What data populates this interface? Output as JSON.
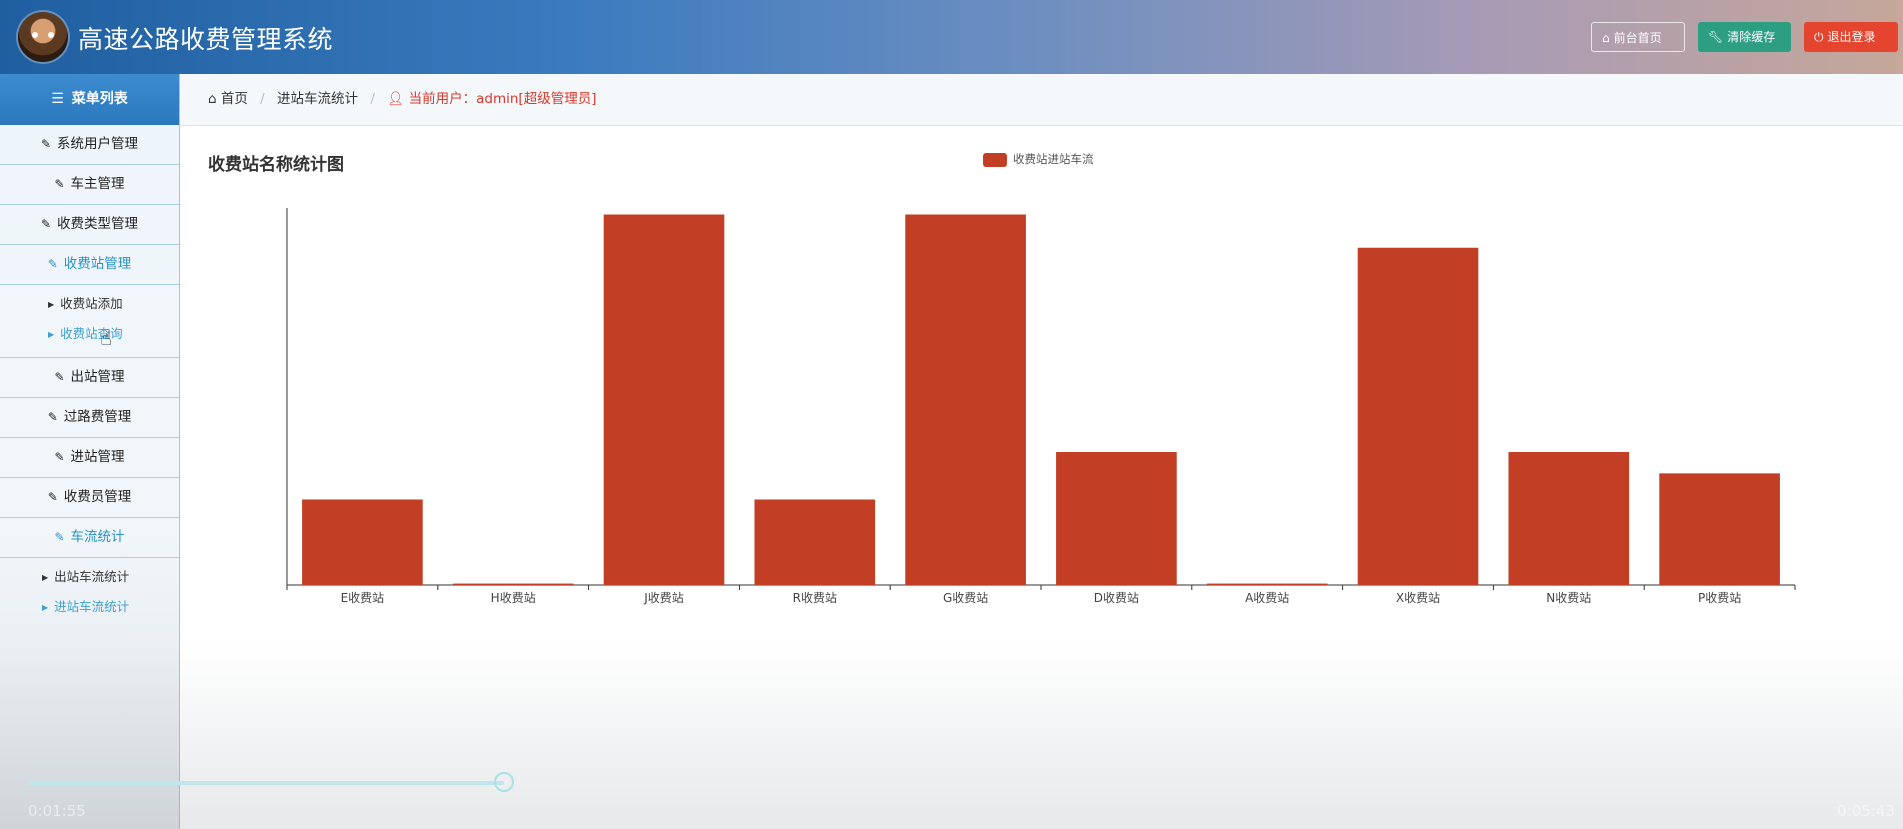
{
  "header": {
    "title": "高速公路收费管理系统",
    "buttons": {
      "home": "前台首页",
      "clear_cache": "清除缓存",
      "logout": "退出登录"
    },
    "icons": {
      "home": "home-icon",
      "clear_cache": "wrench-icon",
      "logout": "power-icon"
    }
  },
  "sidebar": {
    "heading": "菜单列表",
    "items": [
      {
        "label": "系统用户管理"
      },
      {
        "label": "车主管理"
      },
      {
        "label": "收费类型管理"
      },
      {
        "label": "收费站管理",
        "active": true,
        "children": [
          "收费站添加",
          "收费站查询"
        ]
      },
      {
        "label": "出站管理"
      },
      {
        "label": "过路费管理"
      },
      {
        "label": "进站管理"
      },
      {
        "label": "收费员管理"
      },
      {
        "label": "车流统计",
        "active": true,
        "children": [
          "出站车流统计",
          "进站车流统计"
        ]
      }
    ]
  },
  "breadcrumb": {
    "home": "首页",
    "current": "进站车流统计",
    "user": "当前用户：admin[超级管理员]"
  },
  "chart_data": {
    "type": "bar",
    "title": "收费站名称统计图",
    "legend": "收费站进站车流",
    "categories": [
      "E收费站",
      "H收费站",
      "J收费站",
      "R收费站",
      "G收费站",
      "D收费站",
      "A收费站",
      "X收费站",
      "N收费站",
      "P收费站"
    ],
    "values": [
      18,
      0.3,
      78,
      18,
      78,
      28,
      0.3,
      71,
      28,
      23.5
    ],
    "ylim": [
      0,
      80
    ],
    "color": "#c23f26",
    "grid": false
  },
  "player": {
    "elapsed": "0:01:55",
    "total": "0:05:43",
    "progress": 0.34
  }
}
